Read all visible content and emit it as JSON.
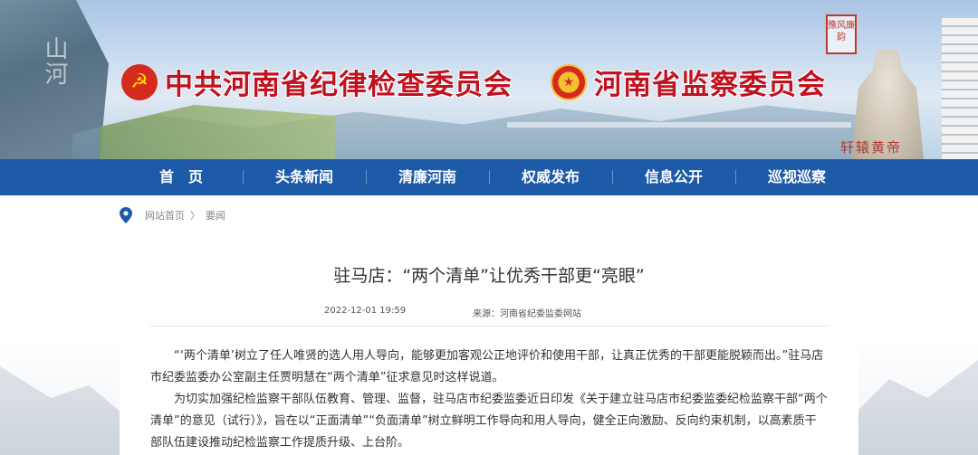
{
  "header": {
    "org1_name": "中共河南省纪律检查委员会",
    "org2_name": "河南省监察委员会",
    "left_calligraphy": "山河",
    "seal_text": "豫风廉韵",
    "statue_caption": "轩辕黄帝"
  },
  "nav": {
    "items": [
      {
        "label": "首　页"
      },
      {
        "label": "头条新闻"
      },
      {
        "label": "清廉河南"
      },
      {
        "label": "权威发布"
      },
      {
        "label": "信息公开"
      },
      {
        "label": "巡视巡察"
      }
    ]
  },
  "breadcrumb": {
    "home": "网站首页",
    "separator": "〉",
    "current": "要闻"
  },
  "article": {
    "title": "驻马店：“两个清单”让优秀干部更“亮眼”",
    "date": "2022-12-01 19:59",
    "source": "来源：河南省纪委监委网站",
    "paragraphs": [
      "“‘两个清单’树立了任人唯贤的选人用人导向，能够更加客观公正地评价和使用干部，让真正优秀的干部更能脱颖而出。”驻马店市纪委监委办公室副主任贾明慧在“两个清单”征求意见时这样说道。",
      "为切实加强纪检监察干部队伍教育、管理、监督，驻马店市纪委监委近日印发《关于建立驻马店市纪委监委纪检监察干部“两个清单”的意见（试行）》，旨在以“正面清单”“负面清单”树立鲜明工作导向和用人导向，健全正向激励、反向约束机制，以高素质干部队伍建设推动纪检监察工作提质升级、上台阶。"
    ]
  },
  "colors": {
    "nav_bg": "#1d5aa8",
    "org_name": "#c1121f"
  }
}
